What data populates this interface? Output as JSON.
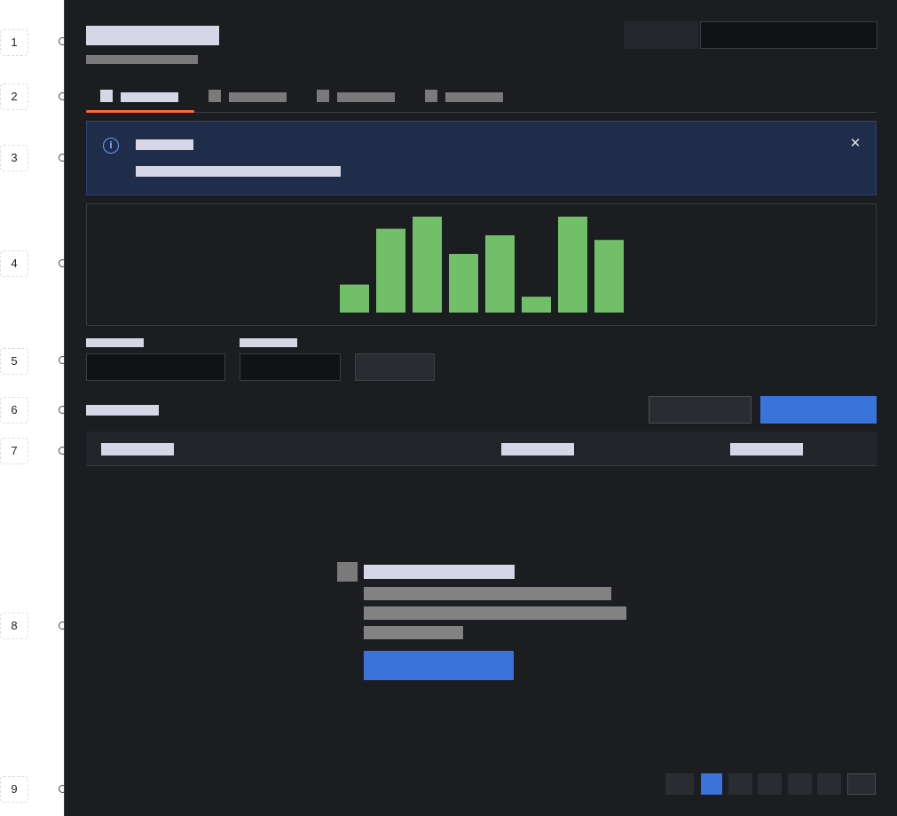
{
  "row_numbers": [
    "1",
    "2",
    "3",
    "4",
    "5",
    "6",
    "7",
    "8",
    "9"
  ],
  "header": {
    "title_placeholder": "",
    "subtitle_placeholder": "",
    "secondary_button": "",
    "search_input_value": ""
  },
  "tabs": [
    {
      "label": "",
      "active": true
    },
    {
      "label": "",
      "active": false
    },
    {
      "label": "",
      "active": false
    },
    {
      "label": "",
      "active": false
    }
  ],
  "banner": {
    "icon": "info-icon",
    "close_icon": "close-icon",
    "close_glyph": "✕",
    "info_glyph": "i"
  },
  "chart_data": {
    "type": "bar",
    "categories": [
      "",
      "",
      "",
      "",
      "",
      "",
      "",
      ""
    ],
    "values": [
      3,
      9,
      10.3,
      6.3,
      8.3,
      1.7,
      10.3,
      7.8
    ],
    "ylim": [
      0,
      10.3
    ],
    "grid": false,
    "color": "#72bf6a"
  },
  "colors": {
    "background": "#1b1d21",
    "accent_blue": "#3b73dc",
    "tab_accent": "#ff6a33",
    "bar_green": "#72bf6a",
    "banner_bg": "#1f2d4a",
    "info_icon": "#6c9ef8"
  },
  "pagination": {
    "pages": [
      "",
      "",
      "",
      "",
      "",
      ""
    ],
    "active_index": 1
  }
}
